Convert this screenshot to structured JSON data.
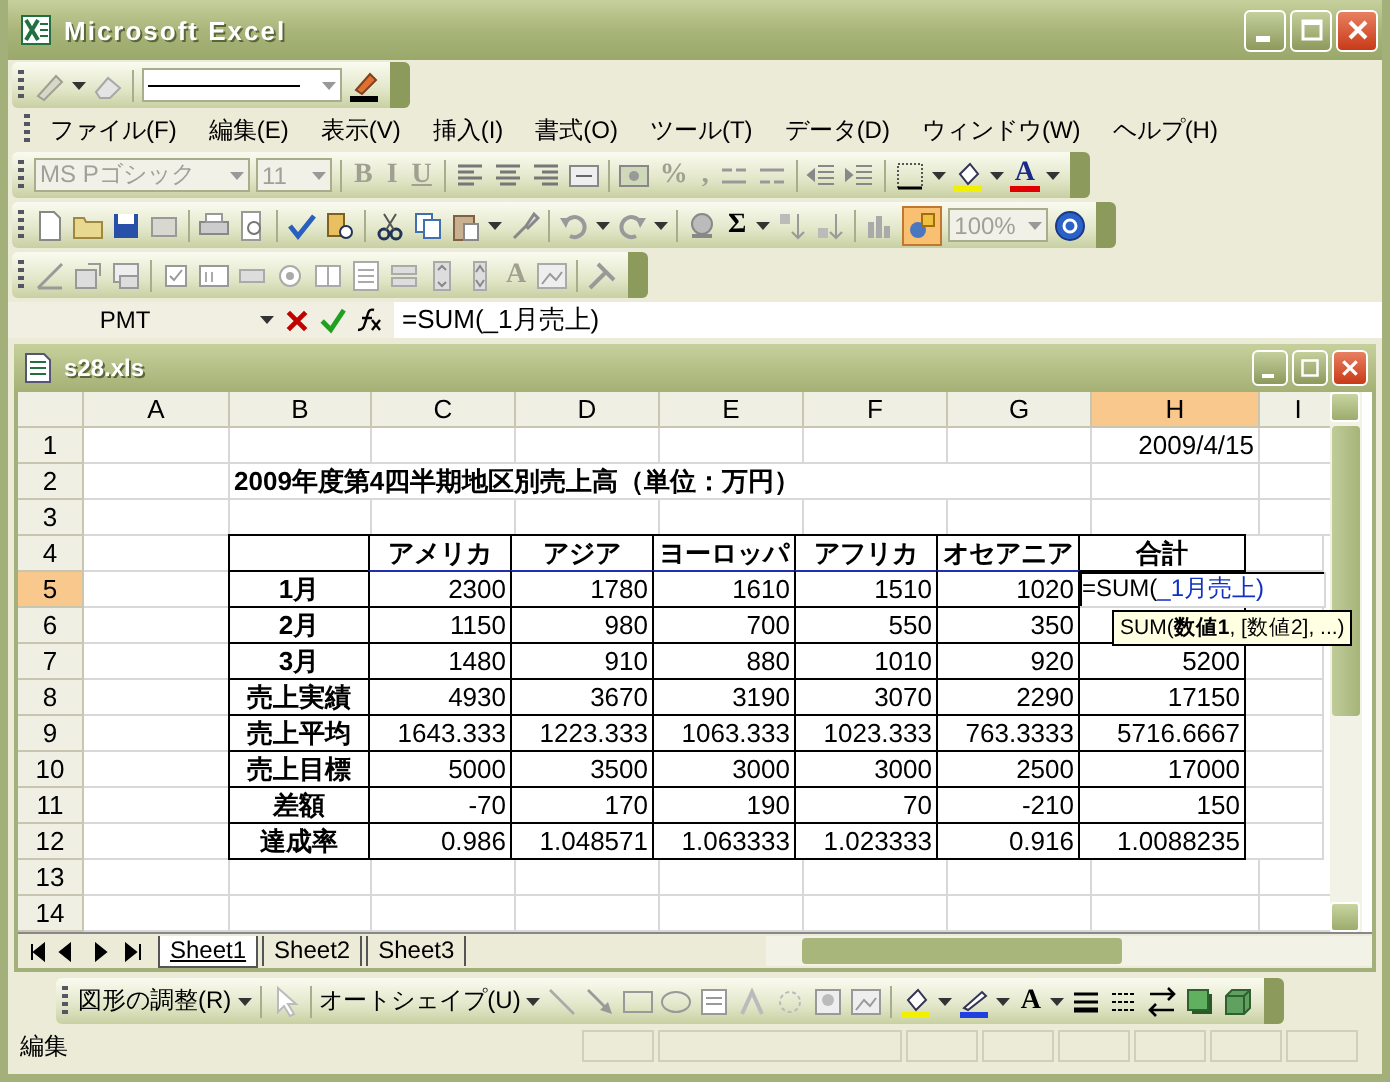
{
  "window": {
    "title": "Microsoft Excel"
  },
  "menu": [
    {
      "label": "ファイル(F)"
    },
    {
      "label": "編集(E)"
    },
    {
      "label": "表示(V)"
    },
    {
      "label": "挿入(I)"
    },
    {
      "label": "書式(O)"
    },
    {
      "label": "ツール(T)"
    },
    {
      "label": "データ(D)"
    },
    {
      "label": "ウィンドウ(W)"
    },
    {
      "label": "ヘルプ(H)"
    }
  ],
  "formatting_toolbar": {
    "font": "MS Pゴシック",
    "size": "11",
    "glyphs": [
      {
        "text": "B",
        "disabled": true
      },
      {
        "text": "I",
        "disabled": true
      },
      {
        "text": "U",
        "disabled": true
      },
      {
        "text": "%",
        "disabled": true
      },
      {
        "text": ",",
        "disabled": true
      },
      {
        "text": "A",
        "disabled": false
      }
    ]
  },
  "standard_toolbar": {
    "glyphs": [
      {
        "text": "Σ",
        "disabled": false
      }
    ],
    "zoom": "100%"
  },
  "forms_toolbar": {
    "glyphs": [
      {
        "text": "A",
        "disabled": true
      }
    ]
  },
  "formula_bar": {
    "name_box": "PMT",
    "formula": "=SUM(_1月売上)"
  },
  "workbook": {
    "title": "s28.xls",
    "columns": [
      {
        "label": "A",
        "selected": false
      },
      {
        "label": "B",
        "selected": false
      },
      {
        "label": "C",
        "selected": false
      },
      {
        "label": "D",
        "selected": false
      },
      {
        "label": "E",
        "selected": false
      },
      {
        "label": "F",
        "selected": false
      },
      {
        "label": "G",
        "selected": false
      },
      {
        "label": "H",
        "selected": true
      },
      {
        "label": "I",
        "selected": false
      }
    ],
    "rows": [
      {
        "number": "1",
        "selected": false,
        "kind": "plain",
        "h": "2009/4/15"
      },
      {
        "number": "2",
        "selected": false,
        "kind": "title",
        "b": "2009年度第4四半期地区別売上高（単位：万円）"
      },
      {
        "number": "3",
        "selected": false,
        "kind": "plain"
      },
      {
        "number": "4",
        "selected": false,
        "kind": "header",
        "c": "アメリカ",
        "d": "アジア",
        "e": "ヨーロッパ",
        "f": "アフリカ",
        "g": "オセアニア",
        "h": "合計"
      },
      {
        "number": "5",
        "selected": true,
        "kind": "data",
        "referenced": true,
        "b": "1月",
        "c": "2300",
        "d": "1780",
        "e": "1610",
        "f": "1510",
        "g": "1020",
        "edit": {
          "prefix": "=SUM(",
          "reference": "_1月売上)"
        }
      },
      {
        "number": "6",
        "selected": false,
        "kind": "data",
        "b": "2月",
        "c": "1150",
        "d": "980",
        "e": "700",
        "f": "550",
        "g": "350"
      },
      {
        "number": "7",
        "selected": false,
        "kind": "data",
        "b": "3月",
        "c": "1480",
        "d": "910",
        "e": "880",
        "f": "1010",
        "g": "920",
        "h": "5200"
      },
      {
        "number": "8",
        "selected": false,
        "kind": "data",
        "b": "売上実績",
        "c": "4930",
        "d": "3670",
        "e": "3190",
        "f": "3070",
        "g": "2290",
        "h": "17150"
      },
      {
        "number": "9",
        "selected": false,
        "kind": "data",
        "b": "売上平均",
        "c": "1643.333",
        "d": "1223.333",
        "e": "1063.333",
        "f": "1023.333",
        "g": "763.3333",
        "h": "5716.6667"
      },
      {
        "number": "10",
        "selected": false,
        "kind": "data",
        "b": "売上目標",
        "c": "5000",
        "d": "3500",
        "e": "3000",
        "f": "3000",
        "g": "2500",
        "h": "17000"
      },
      {
        "number": "11",
        "selected": false,
        "kind": "data",
        "b": "差額",
        "c": "-70",
        "d": "170",
        "e": "190",
        "f": "70",
        "g": "-210",
        "h": "150"
      },
      {
        "number": "12",
        "selected": false,
        "kind": "data",
        "b": "達成率",
        "c": "0.986",
        "d": "1.048571",
        "e": "1.063333",
        "f": "1.023333",
        "g": "0.916",
        "h": "1.0088235"
      },
      {
        "number": "13",
        "selected": false,
        "kind": "plain"
      },
      {
        "number": "14",
        "selected": false,
        "kind": "plain"
      }
    ],
    "tooltip": "SUM(**数値1**, [数値2], ...)",
    "sheet_tabs": [
      {
        "label": "Sheet1",
        "selected": true
      },
      {
        "label": "Sheet2",
        "selected": false
      },
      {
        "label": "Sheet3",
        "selected": false
      }
    ]
  },
  "drawing_toolbar": {
    "menus": [
      {
        "label": "図形の調整(R)"
      },
      {
        "label": "オートシェイプ(U)"
      }
    ],
    "glyphs": [
      {
        "text": "A",
        "disabled": false
      }
    ]
  },
  "status_bar": {
    "mode": "編集"
  }
}
